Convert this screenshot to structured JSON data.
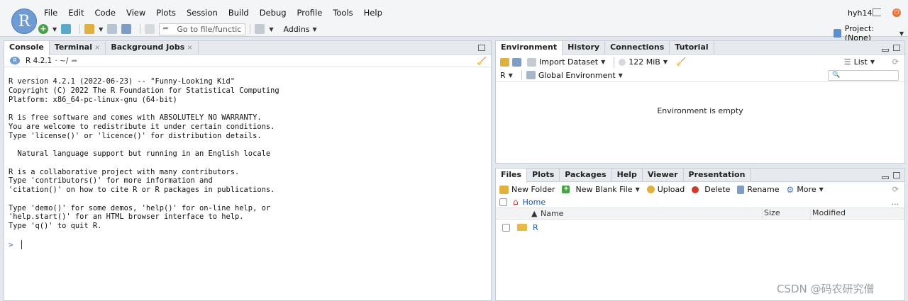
{
  "app": {
    "logo_letter": "R",
    "menu": [
      "File",
      "Edit",
      "Code",
      "View",
      "Plots",
      "Session",
      "Build",
      "Debug",
      "Profile",
      "Tools",
      "Help"
    ],
    "user": "hyh14",
    "goto_placeholder": "Go to file/functic",
    "addins_label": "Addins",
    "project_label": "Project: (None)"
  },
  "console_pane": {
    "tabs": [
      "Console",
      "Terminal",
      "Background Jobs"
    ],
    "tab_close": "×",
    "version_label": "R 4.2.1",
    "path": "· ~/",
    "output": "R version 4.2.1 (2022-06-23) -- \"Funny-Looking Kid\"\nCopyright (C) 2022 The R Foundation for Statistical Computing\nPlatform: x86_64-pc-linux-gnu (64-bit)\n\nR is free software and comes with ABSOLUTELY NO WARRANTY.\nYou are welcome to redistribute it under certain conditions.\nType 'license()' or 'licence()' for distribution details.\n\n  Natural language support but running in an English locale\n\nR is a collaborative project with many contributors.\nType 'contributors()' for more information and\n'citation()' on how to cite R or R packages in publications.\n\nType 'demo()' for some demos, 'help()' for on-line help, or\n'help.start()' for an HTML browser interface to help.\nType 'q()' to quit R.",
    "prompt": ">"
  },
  "env_pane": {
    "tabs": [
      "Environment",
      "History",
      "Connections",
      "Tutorial"
    ],
    "import_label": "Import Dataset",
    "memory_label": "122 MiB",
    "view_label": "List",
    "lang_label": "R",
    "scope_label": "Global Environment",
    "empty_message": "Environment is empty"
  },
  "files_pane": {
    "tabs": [
      "Files",
      "Plots",
      "Packages",
      "Help",
      "Viewer",
      "Presentation"
    ],
    "toolbar": {
      "new_folder": "New Folder",
      "new_blank_file": "New Blank File",
      "upload": "Upload",
      "delete": "Delete",
      "rename": "Rename",
      "more": "More"
    },
    "path_home": "Home",
    "ellipsis": "...",
    "columns": {
      "name": "Name",
      "size": "Size",
      "modified": "Modified"
    },
    "rows": [
      {
        "name": "R",
        "size": "",
        "modified": ""
      }
    ]
  },
  "watermark": "CSDN @码农研究僧"
}
